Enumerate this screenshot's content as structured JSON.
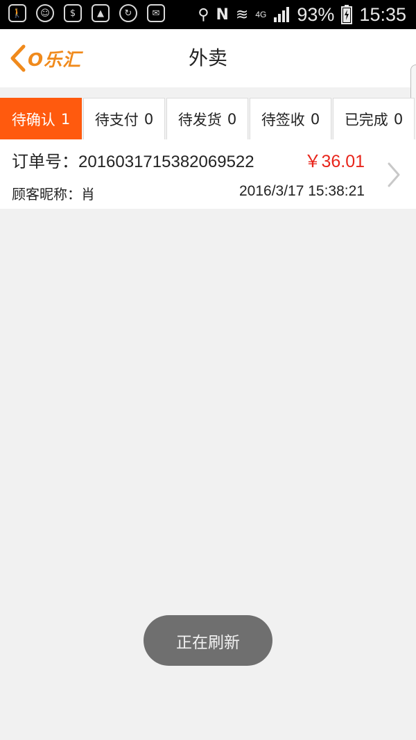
{
  "status_bar": {
    "battery": "93%",
    "time": "15:35",
    "network": "4G",
    "icons": [
      "walk-icon",
      "face-icon",
      "dollar-icon",
      "image-icon",
      "sync-icon",
      "cast-icon",
      "location-icon",
      "nfc-icon",
      "wifi-icon",
      "signal-icon",
      "battery-icon"
    ]
  },
  "header": {
    "back_logo": "O乐汇",
    "title": "外卖"
  },
  "tabs": [
    {
      "label": "待确认",
      "count": "1",
      "active": true
    },
    {
      "label": "待支付",
      "count": "0",
      "active": false
    },
    {
      "label": "待发货",
      "count": "0",
      "active": false
    },
    {
      "label": "待签收",
      "count": "0",
      "active": false
    },
    {
      "label": "已完成",
      "count": "0",
      "active": false
    }
  ],
  "order": {
    "number_label": "订单号：",
    "number": "2016031715382069522",
    "price": "￥36.01",
    "customer_label": "顾客昵称：",
    "customer": "肖",
    "time": "2016/3/17 15:38:21"
  },
  "toast": "正在刷新",
  "colors": {
    "accent": "#ff5a0e",
    "logo": "#f08a1c",
    "price": "#e8251b",
    "background": "#f1f1f1"
  }
}
